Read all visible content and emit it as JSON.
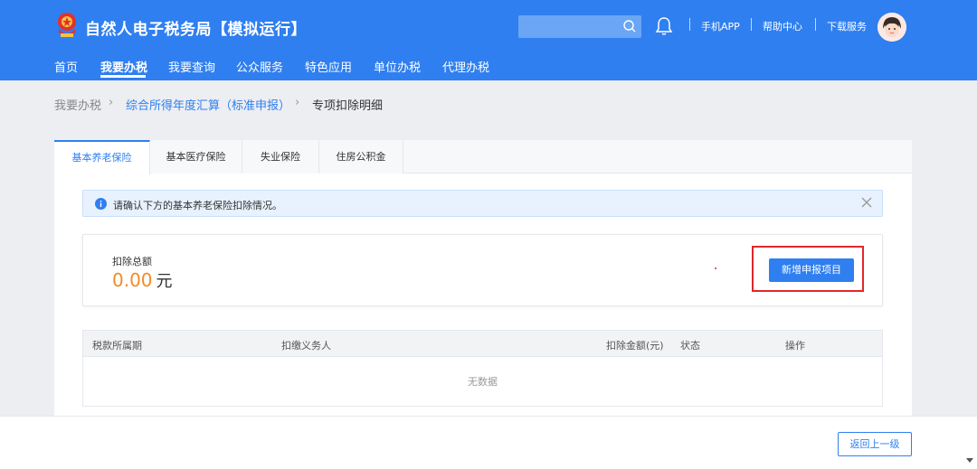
{
  "header": {
    "title": "自然人电子税务局【模拟运行】",
    "search_placeholder": "",
    "links": [
      "手机APP",
      "帮助中心",
      "下载服务"
    ]
  },
  "nav": {
    "items": [
      "首页",
      "我要办税",
      "我要查询",
      "公众服务",
      "特色应用",
      "单位办税",
      "代理办税"
    ],
    "active": "我要办税"
  },
  "breadcrumb": {
    "items": [
      "我要办税",
      "综合所得年度汇算（标准申报）",
      "专项扣除明细"
    ]
  },
  "tabs": {
    "items": [
      "基本养老保险",
      "基本医疗保险",
      "失业保险",
      "住房公积金"
    ],
    "active": "基本养老保险"
  },
  "alert": {
    "text": "请确认下方的基本养老保险扣除情况。"
  },
  "summary": {
    "label": "扣除总额",
    "amount": "0.00",
    "unit": "元",
    "add_button": "新增申报项目"
  },
  "table": {
    "columns": [
      "税款所属期",
      "扣缴义务人",
      "扣除金额(元)",
      "状态",
      "操作"
    ],
    "empty_text": "无数据"
  },
  "footer": {
    "back_button": "返回上一级"
  },
  "colors": {
    "primary": "#2f7ff0",
    "amount": "#f08c28",
    "highlight": "#e0272b"
  }
}
